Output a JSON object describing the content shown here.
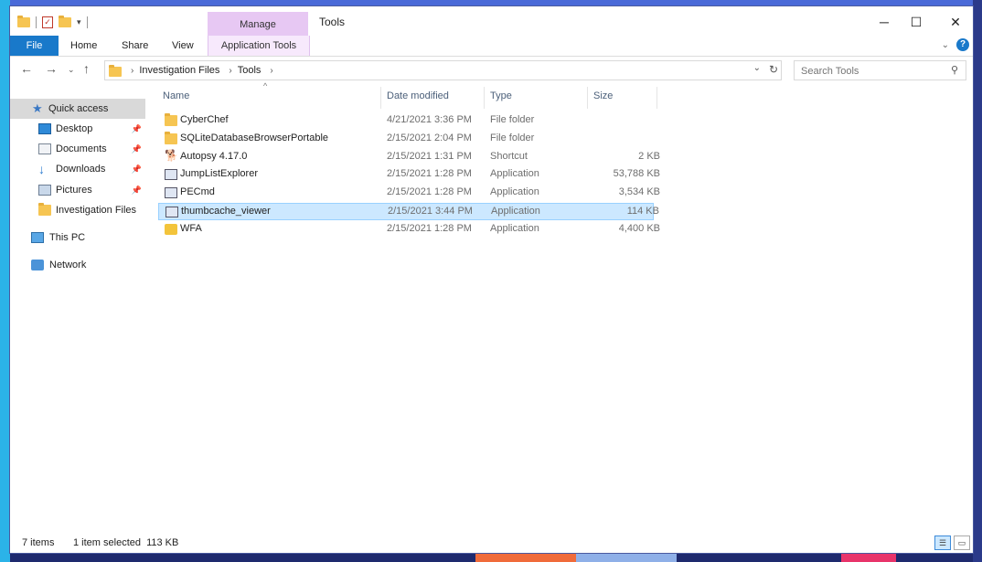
{
  "window": {
    "title": "Tools",
    "manage_label": "Manage",
    "controls": {
      "minimize": "─",
      "maximize": "☐",
      "close": "✕"
    }
  },
  "ribbon": {
    "tabs": [
      "File",
      "Home",
      "Share",
      "View",
      "Application Tools"
    ]
  },
  "address": {
    "crumbs": [
      "Investigation Files",
      "Tools"
    ],
    "search_placeholder": "Search Tools"
  },
  "nav": {
    "items": [
      {
        "label": "Quick access",
        "icon": "star-icon"
      },
      {
        "label": "Desktop",
        "icon": "desktop-icon",
        "pinned": true
      },
      {
        "label": "Documents",
        "icon": "documents-icon",
        "pinned": true
      },
      {
        "label": "Downloads",
        "icon": "downloads-icon",
        "pinned": true
      },
      {
        "label": "Pictures",
        "icon": "pictures-icon",
        "pinned": true
      },
      {
        "label": "Investigation Files",
        "icon": "folder-icon"
      },
      {
        "label": "This PC",
        "icon": "computer-icon"
      },
      {
        "label": "Network",
        "icon": "network-icon"
      }
    ]
  },
  "columns": {
    "name": "Name",
    "date": "Date modified",
    "type": "Type",
    "size": "Size"
  },
  "files": [
    {
      "name": "CyberChef",
      "date": "4/21/2021 3:36 PM",
      "type": "File folder",
      "size": "",
      "icon": "folder-icon"
    },
    {
      "name": "SQLiteDatabaseBrowserPortable",
      "date": "2/15/2021 2:04 PM",
      "type": "File folder",
      "size": "",
      "icon": "folder-icon"
    },
    {
      "name": "Autopsy 4.17.0",
      "date": "2/15/2021 1:31 PM",
      "type": "Shortcut",
      "size": "2 KB",
      "icon": "shortcut-icon"
    },
    {
      "name": "JumpListExplorer",
      "date": "2/15/2021 1:28 PM",
      "type": "Application",
      "size": "53,788 KB",
      "icon": "app-icon"
    },
    {
      "name": "PECmd",
      "date": "2/15/2021 1:28 PM",
      "type": "Application",
      "size": "3,534 KB",
      "icon": "app-icon"
    },
    {
      "name": "thumbcache_viewer",
      "date": "2/15/2021 3:44 PM",
      "type": "Application",
      "size": "114 KB",
      "icon": "app-icon",
      "selected": true
    },
    {
      "name": "WFA",
      "date": "2/15/2021 1:28 PM",
      "type": "Application",
      "size": "4,400 KB",
      "icon": "wfa-icon"
    }
  ],
  "status": {
    "item_count": "7 items",
    "selection": "1 item selected  113 KB"
  },
  "colors": {
    "file_tab": "#1979ca",
    "manage_tab": "#e7c8f3",
    "selection": "#cce8ff"
  }
}
